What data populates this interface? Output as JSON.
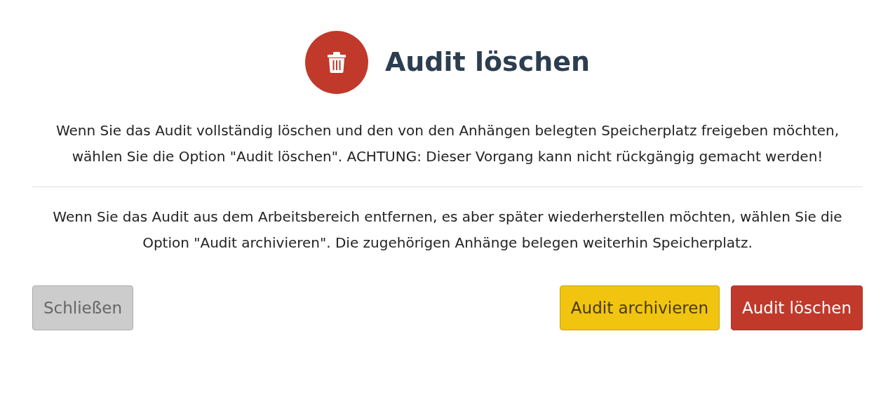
{
  "dialog": {
    "title": "Audit löschen",
    "paragraphs": [
      "Wenn Sie das Audit vollständig löschen und den von den Anhängen belegten Speicherplatz freigeben möchten, wählen Sie die Option \"Audit löschen\". ACHTUNG: Dieser Vorgang kann nicht rückgängig gemacht werden!",
      "Wenn Sie das Audit aus dem Arbeitsbereich entfernen, es aber später wiederherstellen möchten, wählen Sie die Option \"Audit archivieren\". Die zugehörigen Anhänge belegen weiterhin Speicherplatz."
    ],
    "buttons": [
      {
        "label": "Schließen",
        "kind": "secondary"
      },
      {
        "label": "Audit archivieren",
        "kind": "warning"
      },
      {
        "label": "Audit löschen",
        "kind": "danger"
      }
    ]
  }
}
